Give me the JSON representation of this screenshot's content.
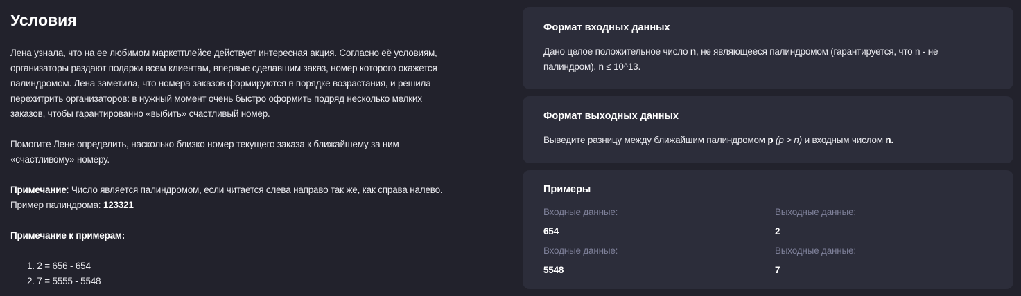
{
  "conditions": {
    "title": "Условия",
    "p1": [
      "Лена узнала, что на ее любимом маркетплейсе действует интересная акция. Согласно её условиям,",
      "организаторы раздают подарки всем клиентам, впервые сделавшим заказ, номер которого окажется",
      "палиндромом. Лена заметила, что номера заказов формируются в порядке возрастания, и решила",
      "перехитрить организаторов: в нужный момент очень быстро оформить подряд несколько мелких",
      "заказов, чтобы гарантированно «выбить» счастливый номер."
    ],
    "p2": [
      "Помогите Лене определить, насколько близко номер текущего заказа к ближайшему за ним",
      "«счастливому» номеру."
    ],
    "note_label": "Примечание",
    "note_text": ": Число является палиндромом, если читается слева направо так же, как справа налево.",
    "example_prefix": "Пример палиндрома: ",
    "example_value": "123321",
    "examples_note_title": "Примечание к примерам:",
    "examples_note": [
      "1. 2 = 656 - 654",
      "2. 7 = 5555 - 5548"
    ]
  },
  "input_format": {
    "title": "Формат входных данных",
    "t1": "Дано целое положительное число ",
    "n": "n",
    "t2": ", не являющееся палиндромом (гарантируется, что n - не",
    "line2": "палиндром), n ≤ 10^13."
  },
  "output_format": {
    "title": "Формат выходных данных",
    "t1": "Выведите разницу между ближайшим палиндромом ",
    "p": "p",
    "cond": " (p > n)",
    "t2": " и входным числом ",
    "n": "n."
  },
  "examples": {
    "title": "Примеры",
    "input_label": "Входные данные:",
    "output_label": "Выходные данные:",
    "rows": [
      {
        "input": "654",
        "output": "2"
      },
      {
        "input": "5548",
        "output": "7"
      }
    ]
  }
}
